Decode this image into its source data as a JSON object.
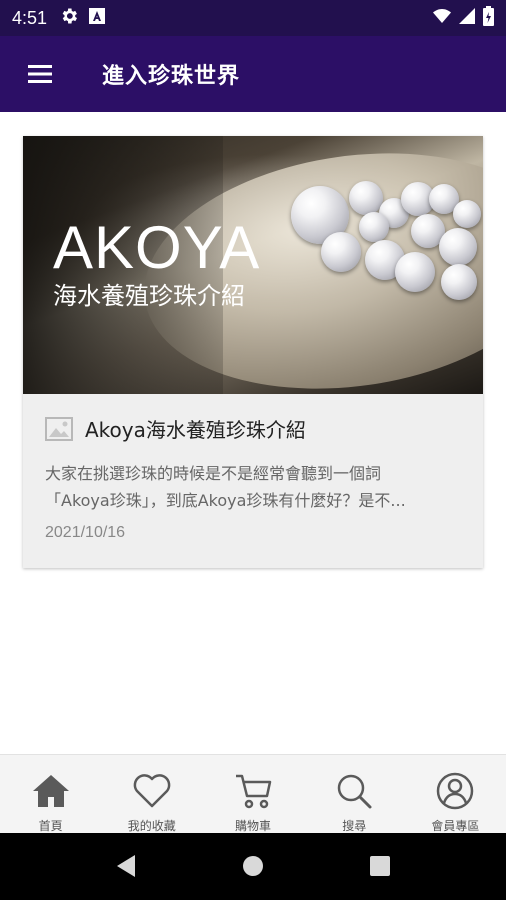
{
  "status_bar": {
    "time": "4:51",
    "icons": [
      "gear-icon",
      "a-badge-icon",
      "wifi-icon",
      "signal-icon",
      "battery-icon"
    ]
  },
  "app_bar": {
    "title": "進入珍珠世界",
    "menu_icon": "hamburger-menu-icon"
  },
  "card": {
    "image": {
      "overlay_title": "AKOYA",
      "overlay_subtitle": "海水養殖珍珠介紹"
    },
    "title": "Akoya海水養殖珍珠介紹",
    "description_lines": [
      "大家在挑選珍珠的時候是不是經常會聽到一個詞",
      "「Akoya珍珠」，到底Akoya珍珠有什麼好？是不..."
    ],
    "date": "2021/10/16"
  },
  "bottom_nav": {
    "items": [
      {
        "label": "首頁",
        "icon": "home-icon"
      },
      {
        "label": "我的收藏",
        "icon": "heart-icon"
      },
      {
        "label": "購物車",
        "icon": "cart-icon"
      },
      {
        "label": "搜尋",
        "icon": "search-icon"
      },
      {
        "label": "會員專區",
        "icon": "user-icon"
      }
    ]
  },
  "system_nav": {
    "icons": [
      "back-icon",
      "home-circle-icon",
      "recents-icon"
    ]
  },
  "colors": {
    "status_bar": "#22104e",
    "app_bar": "#2c0f66",
    "card_bg": "#efefef",
    "nav_bg": "#f4f4f4",
    "nav_icon": "#555555"
  }
}
